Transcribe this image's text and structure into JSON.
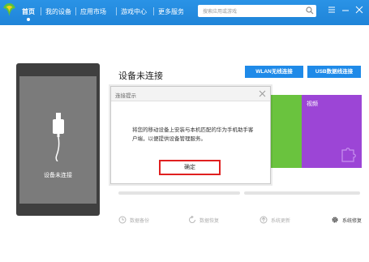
{
  "nav": {
    "items": [
      {
        "label": "首页"
      },
      {
        "label": "我的设备"
      },
      {
        "label": "应用市场"
      },
      {
        "label": "游戏中心"
      },
      {
        "label": "更多服务"
      }
    ],
    "active_index": 0
  },
  "search": {
    "placeholder": "搜索应用或游戏"
  },
  "device": {
    "status_label": "设备未连接"
  },
  "main": {
    "title": "设备未连接",
    "wlan_button": "WLAN无线连接",
    "usb_button": "USB数据线连接",
    "tiles": [
      {
        "label": "",
        "color": "#6ac33e"
      },
      {
        "label": "视频",
        "color": "#9c45d6"
      }
    ]
  },
  "tools": [
    {
      "label": "数据备份",
      "icon": "clock-icon"
    },
    {
      "label": "数据恢复",
      "icon": "restore-icon"
    },
    {
      "label": "系统更新",
      "icon": "update-icon"
    },
    {
      "label": "系统修复",
      "icon": "gear-icon"
    }
  ],
  "dialog": {
    "title": "连接提示",
    "message": "将您的移动设备上安装与本机匹配的华为手机助手客户端，以便提供设备管理服务。",
    "ok_button": "确定"
  },
  "colors": {
    "brand_blue": "#1f84d8",
    "button_blue": "#1f8ae8",
    "highlight_red": "#e02020"
  }
}
